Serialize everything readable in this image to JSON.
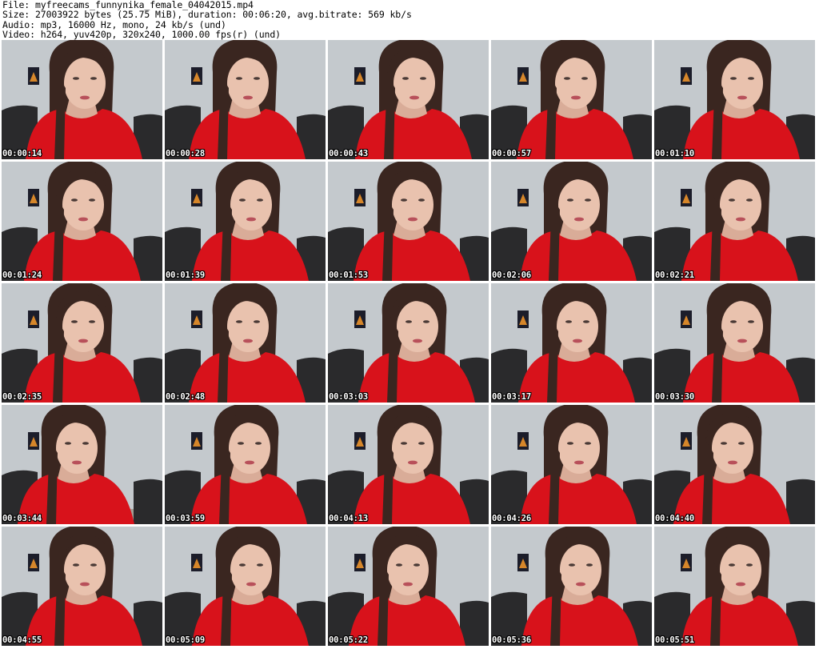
{
  "header": {
    "file": "File: myfreecams_funnynika_female_04042015.mp4",
    "size": "Size: 27003922 bytes (25.75 MiB), duration: 00:06:20, avg.bitrate: 569 kb/s",
    "audio": "Audio: mp3, 16000 Hz, mono, 24 kb/s (und)",
    "video": "Video: h264, yuv420p, 320x240, 1000.00 fps(r) (und)"
  },
  "frames": [
    {
      "timestamp": "00:00:14"
    },
    {
      "timestamp": "00:00:28"
    },
    {
      "timestamp": "00:00:43"
    },
    {
      "timestamp": "00:00:57"
    },
    {
      "timestamp": "00:01:10"
    },
    {
      "timestamp": "00:01:24"
    },
    {
      "timestamp": "00:01:39"
    },
    {
      "timestamp": "00:01:53"
    },
    {
      "timestamp": "00:02:06"
    },
    {
      "timestamp": "00:02:21"
    },
    {
      "timestamp": "00:02:35"
    },
    {
      "timestamp": "00:02:48"
    },
    {
      "timestamp": "00:03:03"
    },
    {
      "timestamp": "00:03:17"
    },
    {
      "timestamp": "00:03:30"
    },
    {
      "timestamp": "00:03:44"
    },
    {
      "timestamp": "00:03:59"
    },
    {
      "timestamp": "00:04:13"
    },
    {
      "timestamp": "00:04:26"
    },
    {
      "timestamp": "00:04:40"
    },
    {
      "timestamp": "00:04:55"
    },
    {
      "timestamp": "00:05:09"
    },
    {
      "timestamp": "00:05:22"
    },
    {
      "timestamp": "00:05:36"
    },
    {
      "timestamp": "00:05:51"
    }
  ],
  "colors": {
    "wall": "#c4c9cd",
    "shirt": "#d8121b",
    "hair": "#3a2620",
    "skin": "#e9c2ae",
    "chair": "#2a2a2c",
    "poster": "#1c1d2a"
  }
}
